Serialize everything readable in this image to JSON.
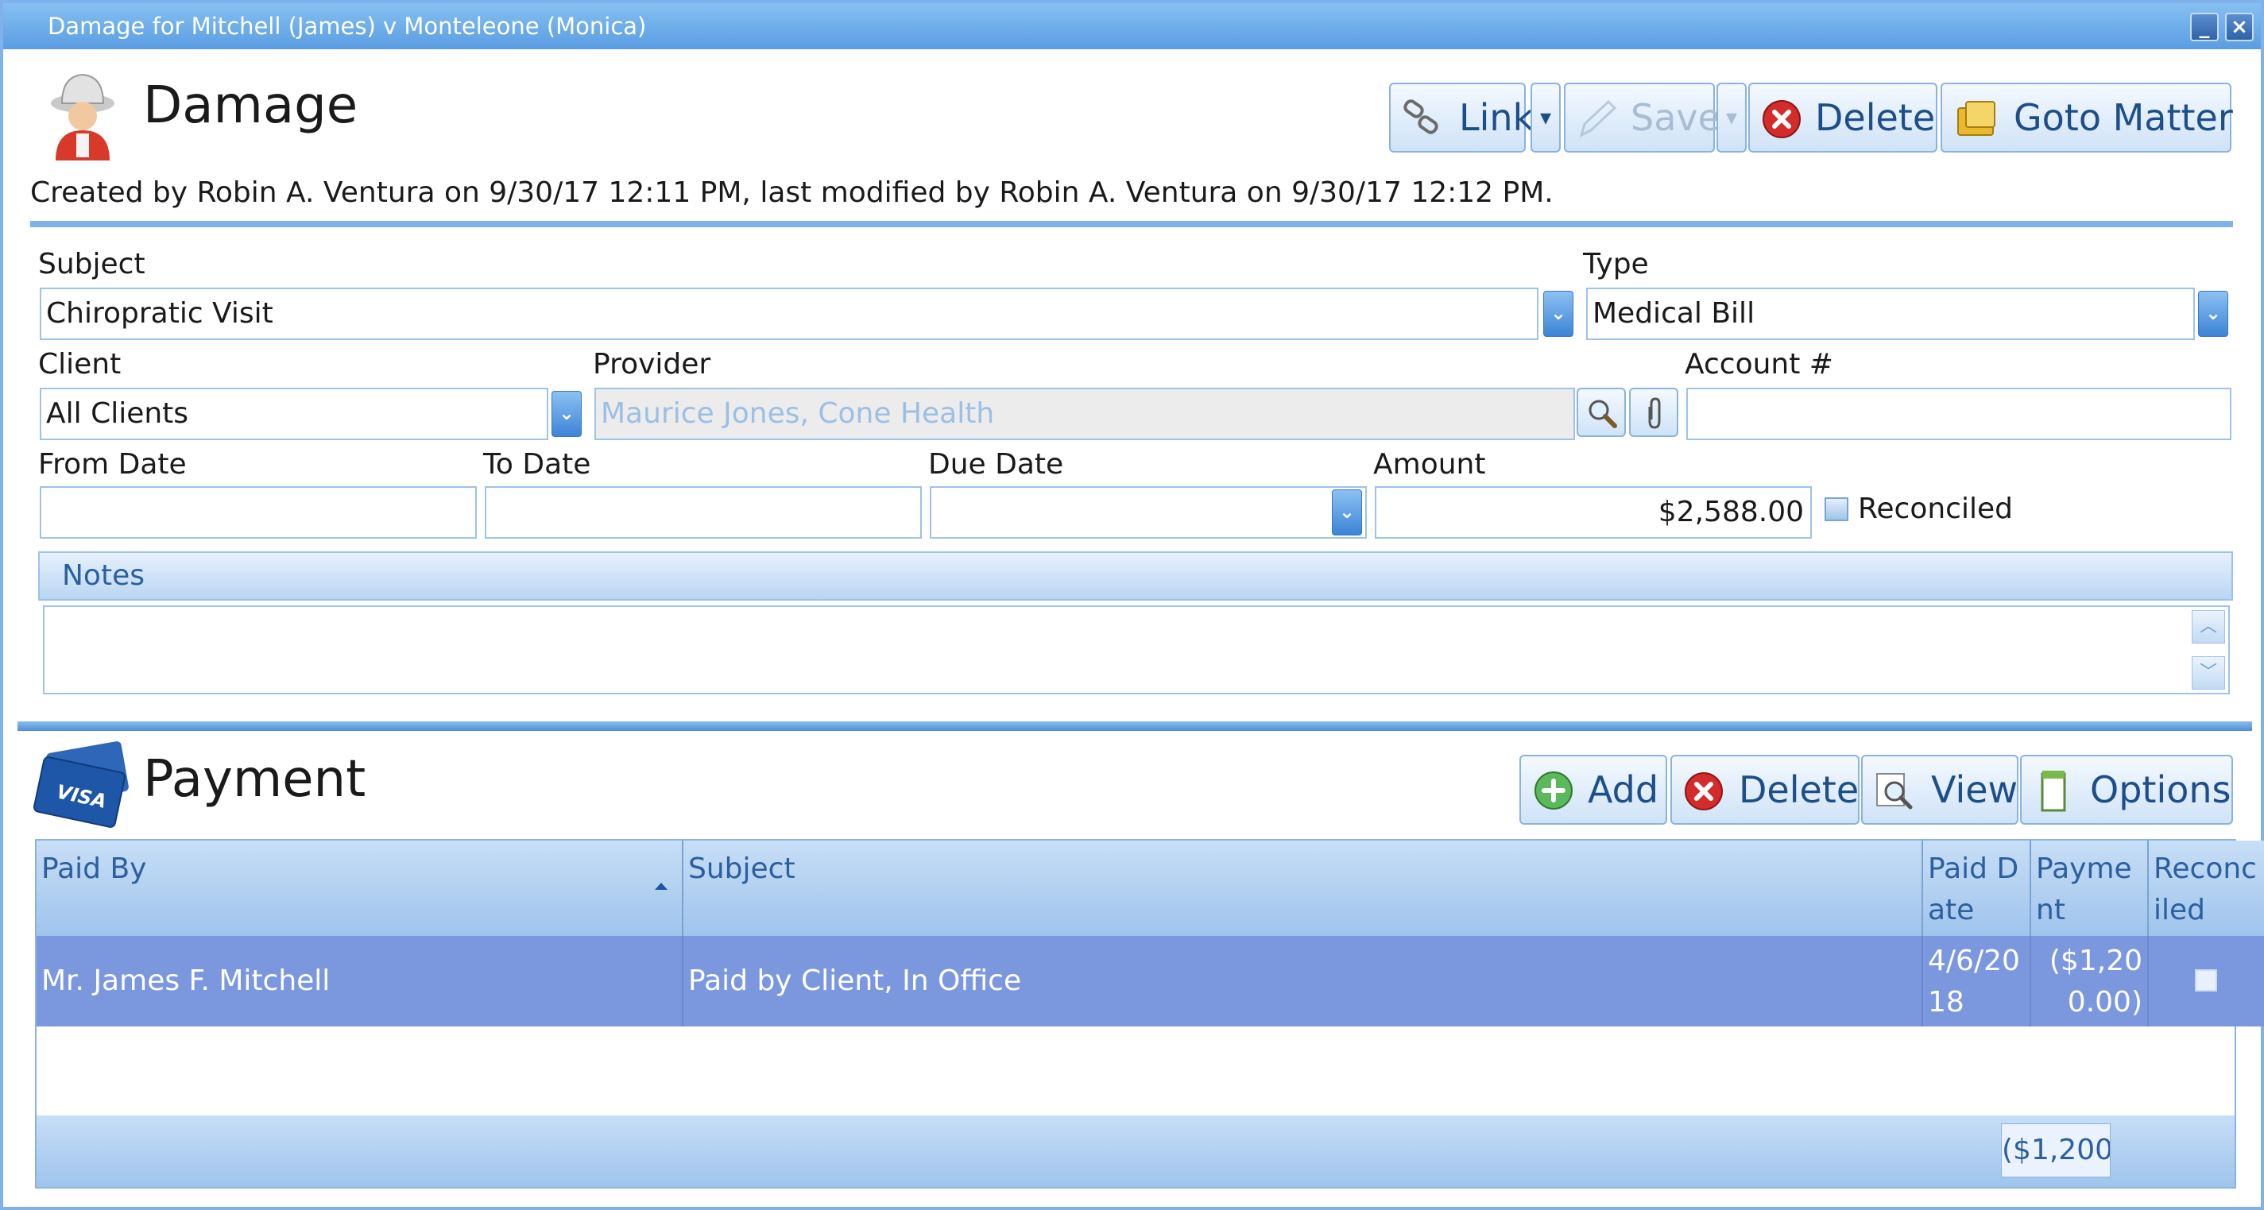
{
  "window": {
    "title": "Damage for Mitchell (James) v Monteleone (Monica)"
  },
  "damage": {
    "heading": "Damage",
    "toolbar": {
      "link_label": "Link",
      "save_label": "Save",
      "delete_label": "Delete",
      "goto_label": "Goto Matter"
    },
    "meta": "Created by Robin A. Ventura on 9/30/17 12:11 PM, last modified by Robin A. Ventura on 9/30/17 12:12 PM.",
    "form": {
      "subject_label": "Subject",
      "subject_value": "Chiropratic Visit",
      "type_label": "Type",
      "type_value": "Medical Bill",
      "client_label": "Client",
      "client_value": "All Clients",
      "provider_label": "Provider",
      "provider_value": "Maurice Jones, Cone Health",
      "account_label": "Account #",
      "account_value": "",
      "from_label": "From Date",
      "from_value": "",
      "to_label": "To Date",
      "to_value": "",
      "due_label": "Due Date",
      "due_value": "",
      "amount_label": "Amount",
      "amount_value": "$2,588.00",
      "reconciled_label": "Reconciled",
      "reconciled_checked": false,
      "notes_label": "Notes",
      "notes_value": ""
    }
  },
  "payment": {
    "heading": "Payment",
    "card_icon_text": "VISA",
    "toolbar": {
      "add_label": "Add",
      "delete_label": "Delete",
      "view_label": "View",
      "options_label": "Options"
    },
    "columns": {
      "paid_by": "Paid By",
      "subject": "Subject",
      "paid_date": "Paid Date",
      "payment": "Payment",
      "reconciled": "Reconciled"
    },
    "rows": [
      {
        "paid_by": "Mr. James F. Mitchell",
        "subject": "Paid by Client, In Office",
        "paid_date": "4/6/2018",
        "payment": "($1,200.00)",
        "reconciled": false
      }
    ],
    "total": "($1,200"
  }
}
